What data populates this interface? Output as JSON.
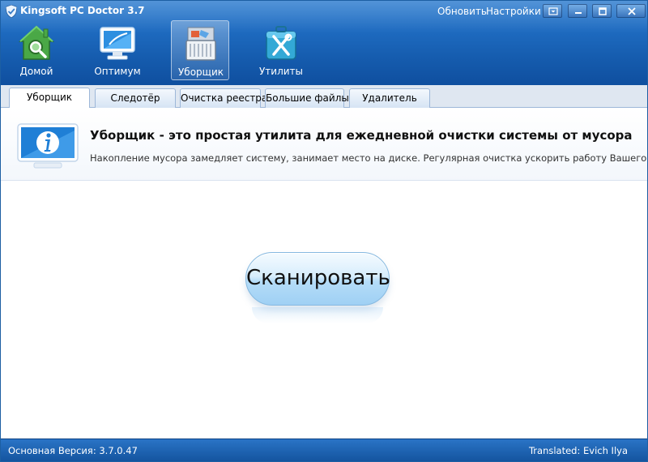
{
  "window": {
    "title": "Kingsoft PC Doctor 3.7",
    "links": {
      "update": "Обновить",
      "settings": "Настройки"
    },
    "icons": {
      "logo": "shield-icon",
      "menu": "dropdown-menu-icon",
      "minimize": "minimize-icon",
      "maximize": "maximize-icon",
      "close": "close-icon"
    }
  },
  "toolbar": {
    "items": [
      {
        "label": "Домой",
        "icon": "home-icon",
        "active": false
      },
      {
        "label": "Оптимум",
        "icon": "monitor-icon",
        "active": false
      },
      {
        "label": "Уборщик",
        "icon": "cleaner-icon",
        "active": true
      },
      {
        "label": "Утилиты",
        "icon": "toolbox-icon",
        "active": false
      }
    ]
  },
  "tabs": [
    {
      "label": "Уборщик",
      "active": true
    },
    {
      "label": "Следотёр",
      "active": false
    },
    {
      "label": "Очистка реестра",
      "active": false
    },
    {
      "label": "Большие файлы",
      "active": false
    },
    {
      "label": "Удалитель",
      "active": false
    }
  ],
  "info": {
    "icon": "info-monitor-icon",
    "title": "Уборщик - это простая утилита для ежедневной очистки системы от мусора",
    "description": "Накопление мусора замедляет систему, занимает место на диске. Регулярная очистка ускорить работу Вашего ПК."
  },
  "main": {
    "scan_label": "Сканировать"
  },
  "status": {
    "version": "Основная Версия: 3.7.0.47",
    "credit": "Translated: Evich Ilya"
  },
  "colors": {
    "header": "#1e6bc0",
    "tab_strip": "#dfe7f1",
    "scan_button": "#b4dcf8",
    "status_bar": "#1a62b3"
  }
}
